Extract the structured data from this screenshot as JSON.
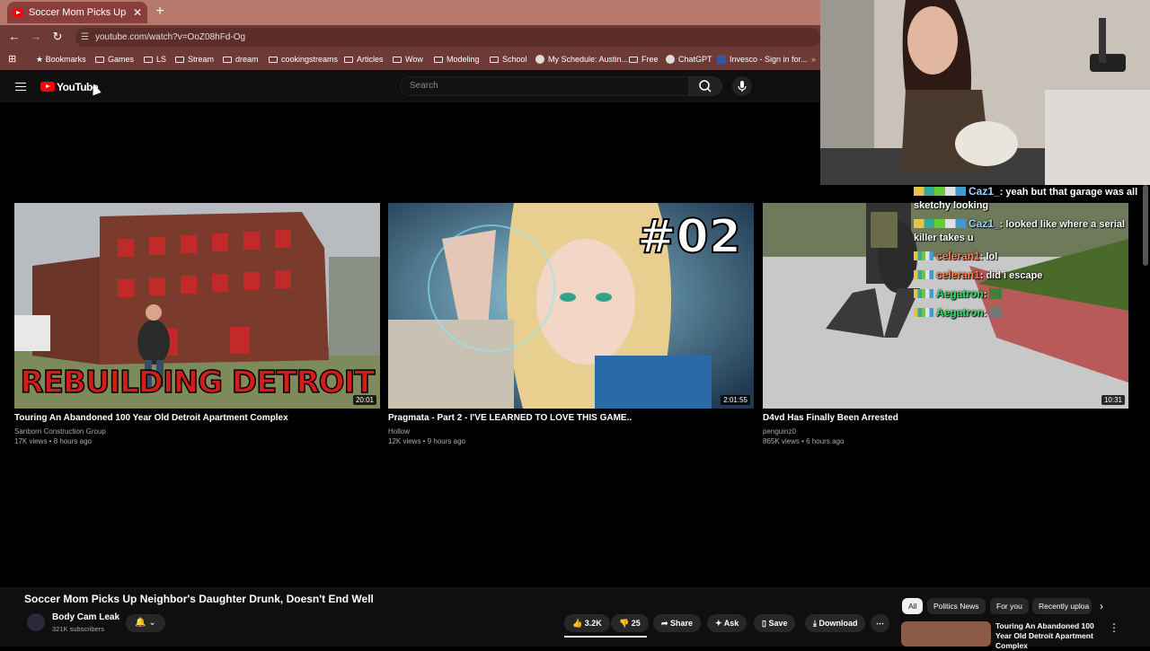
{
  "browser": {
    "tab_title": "Soccer Mom Picks Up Neighbo",
    "url": "youtube.com/watch?v=OoZ08hFd-Og",
    "bookmarks": [
      {
        "label": "Bookmarks",
        "icon": "star-icon"
      },
      {
        "label": "Games",
        "icon": "folder-icon"
      },
      {
        "label": "LS",
        "icon": "folder-icon"
      },
      {
        "label": "Stream",
        "icon": "folder-icon"
      },
      {
        "label": "dream",
        "icon": "folder-icon"
      },
      {
        "label": "cookingstreams",
        "icon": "folder-icon"
      },
      {
        "label": "Articles",
        "icon": "folder-icon"
      },
      {
        "label": "Wow",
        "icon": "folder-icon"
      },
      {
        "label": "Modeling",
        "icon": "folder-icon"
      },
      {
        "label": "School",
        "icon": "folder-icon"
      },
      {
        "label": "My Schedule: Austin...",
        "icon": "globe-icon"
      },
      {
        "label": "Free",
        "icon": "folder-icon"
      },
      {
        "label": "ChatGPT",
        "icon": "chatgpt-icon"
      },
      {
        "label": "Invesco - Sign in for...",
        "icon": "invesco-icon"
      }
    ]
  },
  "youtube": {
    "logo_text": "YouTube",
    "search_placeholder": "Search"
  },
  "endscreen": [
    {
      "title": "Touring An Abandoned 100 Year Old Detroit Apartment Complex",
      "channel": "Sanborn Construction Group",
      "meta": "17K views • 8 hours ago",
      "duration": "20:01",
      "overlay": "REBUILDING DETROIT"
    },
    {
      "title": "Pragmata - Part 2 - I'VE LEARNED TO LOVE THIS GAME..",
      "channel": "Hollow",
      "meta": "12K views • 9 hours ago",
      "duration": "2:01:55",
      "overlay": "#02"
    },
    {
      "title": "D4vd Has Finally Been Arrested",
      "channel": "penguinz0",
      "meta": "865K views • 6 hours ago",
      "duration": "10:31",
      "overlay": ""
    }
  ],
  "chat": [
    {
      "user": "Caz1_",
      "text": "yeah but that garage was all sketchy looking",
      "color": "#9fd3ff"
    },
    {
      "user": "Caz1_",
      "text": "looked like where a serial killer takes u",
      "color": "#9fd3ff"
    },
    {
      "user": "celeran1",
      "text": "lol",
      "color": "#ff7f50"
    },
    {
      "user": "celeran1",
      "text": "did i escape",
      "color": "#ff7f50"
    },
    {
      "user": "Aegatron",
      "text": "",
      "color": "#33dd66"
    },
    {
      "user": "Aegatron",
      "text": "",
      "color": "#33dd66"
    }
  ],
  "video": {
    "title": "Soccer Mom Picks Up Neighbor's Daughter Drunk, Doesn't End Well",
    "channel": "Body Cam Leak",
    "subscribers": "321K subscribers",
    "likes": "3.2K",
    "dislikes": "25",
    "share": "Share",
    "ask": "Ask",
    "save": "Save",
    "download": "Download"
  },
  "chips": [
    "All",
    "Politics News",
    "For you",
    "Recently uploa"
  ],
  "up_next": {
    "title": "Touring An Abandoned 100 Year Old Detroit Apartment Complex"
  }
}
